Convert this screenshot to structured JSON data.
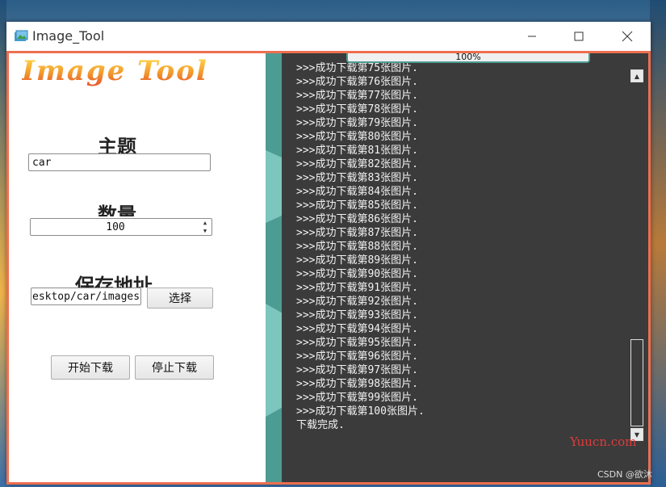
{
  "window": {
    "title": "Image_Tool",
    "minimize_icon": "minimize-icon",
    "maximize_icon": "maximize-icon",
    "close_icon": "close-icon"
  },
  "left": {
    "logo": "Image Tool",
    "topic_label": "主题",
    "topic_value": "car",
    "count_label": "数量",
    "count_value": "100",
    "path_label": "保存地址",
    "path_value": "esktop/car/images",
    "choose_button": "选择",
    "start_button": "开始下载",
    "stop_button": "停止下载"
  },
  "progress": {
    "value": 100,
    "text": "100%"
  },
  "log": {
    "lines": [
      ">>>成功下载第75张图片.",
      ">>>成功下载第76张图片.",
      ">>>成功下载第77张图片.",
      ">>>成功下载第78张图片.",
      ">>>成功下载第79张图片.",
      ">>>成功下载第80张图片.",
      ">>>成功下载第81张图片.",
      ">>>成功下载第82张图片.",
      ">>>成功下载第83张图片.",
      ">>>成功下载第84张图片.",
      ">>>成功下载第85张图片.",
      ">>>成功下载第86张图片.",
      ">>>成功下载第87张图片.",
      ">>>成功下载第88张图片.",
      ">>>成功下载第89张图片.",
      ">>>成功下载第90张图片.",
      ">>>成功下载第91张图片.",
      ">>>成功下载第92张图片.",
      ">>>成功下载第93张图片.",
      ">>>成功下载第94张图片.",
      ">>>成功下载第95张图片.",
      ">>>成功下载第96张图片.",
      ">>>成功下载第97张图片.",
      ">>>成功下载第98张图片.",
      ">>>成功下载第99张图片.",
      ">>>成功下载第100张图片.",
      "下载完成."
    ]
  },
  "watermarks": {
    "site": "Yuucn.com",
    "csdn": "CSDN @欲沐"
  },
  "colors": {
    "border": "#ee6f4f",
    "divider": "#4d9c93",
    "log_bg": "#3b3b3b"
  }
}
